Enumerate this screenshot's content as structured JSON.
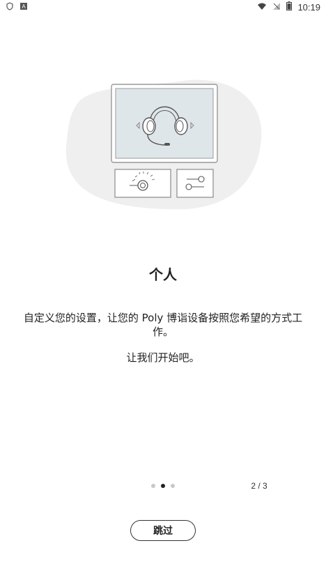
{
  "status_bar": {
    "time": "10:19",
    "left_icons": [
      "shield-icon",
      "a-icon"
    ],
    "right_icons": [
      "wifi-icon",
      "no-signal-icon",
      "battery-icon"
    ]
  },
  "onboarding": {
    "title": "个人",
    "description_line1": "自定义您的设置，让您的 Poly 博诣设备按照您希望的方式工作。",
    "description_line2": "让我们开始吧。",
    "page_indicator": "2 / 3",
    "current_page": 2,
    "total_pages": 3,
    "skip_label": "跳过"
  },
  "colors": {
    "accent": "#222222",
    "blob": "#efefef",
    "screen": "#dfe6ea",
    "dot_inactive": "#c8c8c8"
  }
}
